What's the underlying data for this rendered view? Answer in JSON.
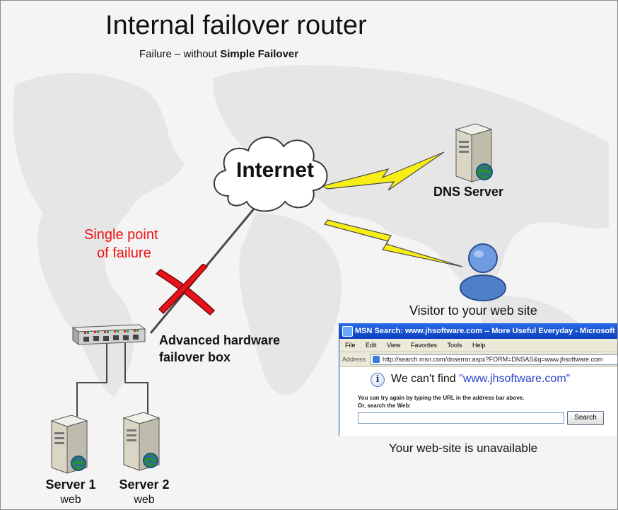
{
  "title": "Internal failover router",
  "subtitle": {
    "prefix": "Failure – without ",
    "emphasis": "Simple Failover"
  },
  "cloud": {
    "label": "Internet",
    "icon": "cloud-icon"
  },
  "dns_server": {
    "label": "DNS Server",
    "icon": "server-tower-icon"
  },
  "single_point_of_failure": {
    "line1": "Single point",
    "line2": "of failure",
    "color": "#ee1111",
    "marker_icon": "red-x-icon"
  },
  "failover_box": {
    "line1": "Advanced hardware",
    "line2": "failover box",
    "icon": "network-switch-icon"
  },
  "visitor": {
    "label": "Visitor to your web site",
    "icon": "user-icon"
  },
  "servers": [
    {
      "name": "Server 1",
      "sub": "web",
      "icon": "server-tower-icon"
    },
    {
      "name": "Server 2",
      "sub": "web",
      "icon": "server-tower-icon"
    }
  ],
  "browser": {
    "title": "MSN Search: www.jhsoftware.com -- More Useful Everyday - Microsoft",
    "menu": [
      "File",
      "Edit",
      "View",
      "Favorites",
      "Tools",
      "Help"
    ],
    "address_label": "Address",
    "address_value": "http://search.msn.com/dnserror.aspx?FORM=DNSAS&q=www.jhsoftware.com",
    "message_prefix": "We can't find ",
    "message_quoted": "\"www.jhsoftware.com\"",
    "hint_line1": "You can try again by typing the URL in the address bar above.",
    "hint_line2": "Or, search the Web:",
    "search_button": "Search",
    "search_value": "",
    "info_icon": "info-icon"
  },
  "unavailable_caption": "Your web-site is unavailable",
  "colors": {
    "lightning": "#f7ee18",
    "red_x": "#e8121b",
    "browser_titlebar": "#0a3fbe"
  }
}
